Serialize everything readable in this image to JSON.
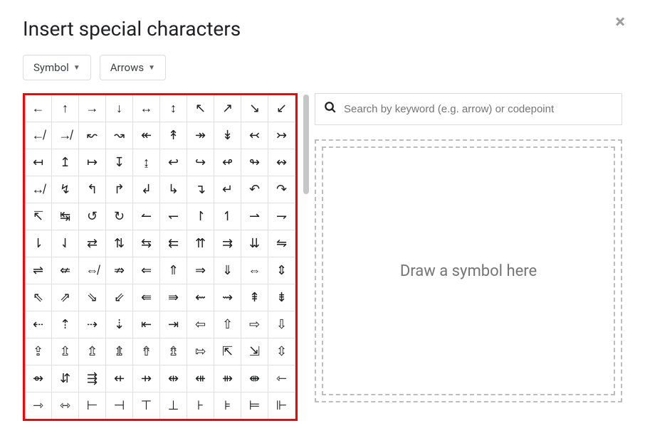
{
  "title": "Insert special characters",
  "dropdowns": {
    "category": "Symbol",
    "subcategory": "Arrows"
  },
  "search": {
    "placeholder": "Search by keyword (e.g. arrow) or codepoint"
  },
  "drawArea": {
    "text": "Draw a symbol here"
  },
  "characters": [
    "←",
    "↑",
    "→",
    "↓",
    "↔",
    "↕",
    "↖",
    "↗",
    "↘",
    "↙",
    "↚",
    "↛",
    "↜",
    "↝",
    "↞",
    "↟",
    "↠",
    "↡",
    "↢",
    "↣",
    "↤",
    "↥",
    "↦",
    "↧",
    "↨",
    "↩",
    "↪",
    "↫",
    "↬",
    "↭",
    "↮",
    "↯",
    "↰",
    "↱",
    "↲",
    "↳",
    "↴",
    "↵",
    "↶",
    "↷",
    "↸",
    "↹",
    "↺",
    "↻",
    "↼",
    "↽",
    "↾",
    "↿",
    "⇀",
    "⇁",
    "⇂",
    "⇃",
    "⇄",
    "⇅",
    "⇆",
    "⇇",
    "⇈",
    "⇉",
    "⇊",
    "⇋",
    "⇌",
    "⇍",
    "⇎",
    "⇏",
    "⇐",
    "⇑",
    "⇒",
    "⇓",
    "⇔",
    "⇕",
    "⇖",
    "⇗",
    "⇘",
    "⇙",
    "⇚",
    "⇛",
    "⇜",
    "⇝",
    "⇞",
    "⇟",
    "⇠",
    "⇡",
    "⇢",
    "⇣",
    "⇤",
    "⇥",
    "⇦",
    "⇧",
    "⇨",
    "⇩",
    "⇪",
    "⇫",
    "⇬",
    "⇭",
    "⇮",
    "⇯",
    "⇰",
    "⇱",
    "⇲",
    "⇳",
    "⇴",
    "⇵",
    "⇶",
    "⇷",
    "⇸",
    "⇹",
    "⇺",
    "⇻",
    "⇼",
    "⇽",
    "⇾",
    "⇿",
    "⊢",
    "⊣",
    "⊤",
    "⊥",
    "⊦",
    "⊧",
    "⊨",
    "⊩"
  ]
}
